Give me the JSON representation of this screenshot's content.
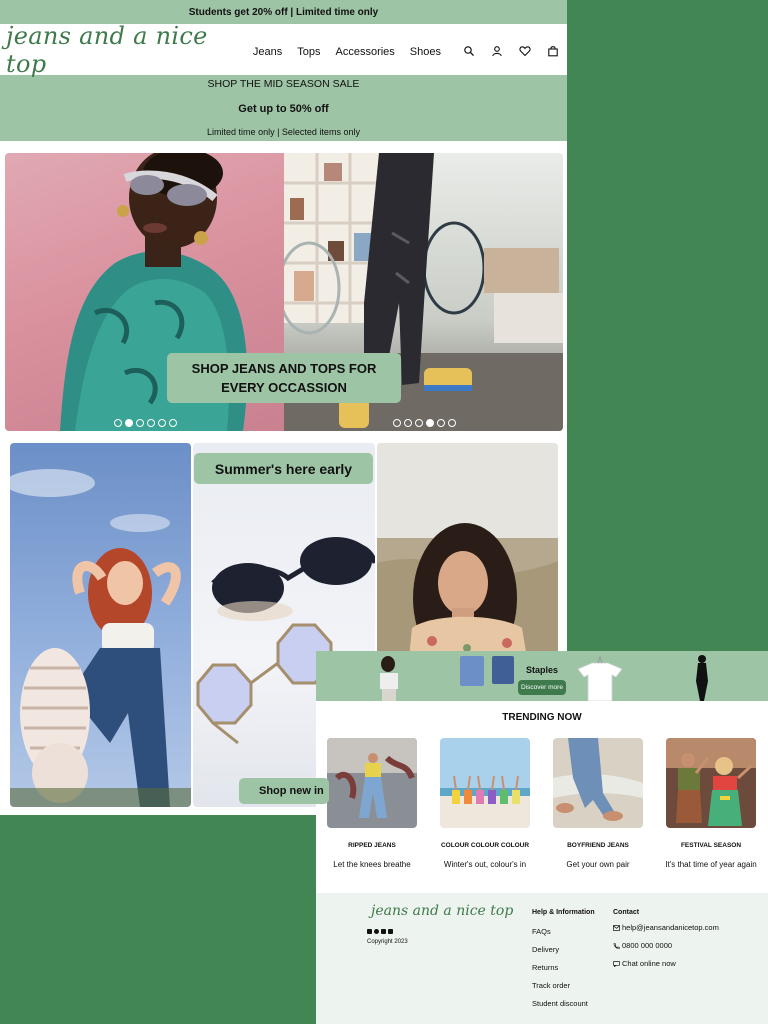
{
  "topbar": {
    "promo": "Students get 20% off | Limited time only"
  },
  "header": {
    "logo": "jeans and a nice top",
    "nav": [
      {
        "label": "Jeans"
      },
      {
        "label": "Tops"
      },
      {
        "label": "Accessories"
      },
      {
        "label": "Shoes"
      }
    ]
  },
  "sale_banner": {
    "line1": "SHOP THE MID SEASON SALE",
    "line2": "Get up to 50% off",
    "line3": "Limited time only | Selected items only"
  },
  "hero": {
    "caption": "SHOP JEANS AND TOPS FOR EVERY OCCASSION",
    "left_dots": {
      "count": 6,
      "active": 2
    },
    "right_dots": {
      "count": 6,
      "active": 4
    }
  },
  "feature_grid": {
    "summer_label": "Summer's here early",
    "shop_button": "Shop new in"
  },
  "staples": {
    "title": "Staples",
    "button": "Discover more"
  },
  "trending": {
    "title": "TRENDING NOW",
    "items": [
      {
        "name": "RIPPED JEANS",
        "tagline": "Let the knees breathe"
      },
      {
        "name": "COLOUR COLOUR COLOUR",
        "tagline": "Winter's out, colour's in"
      },
      {
        "name": "BOYFRIEND JEANS",
        "tagline": "Get your own pair"
      },
      {
        "name": "FESTIVAL SEASON",
        "tagline": "It's that time of year again"
      }
    ]
  },
  "footer": {
    "logo": "jeans and a nice top",
    "copyright": "Copyright 2023",
    "help": {
      "heading": "Help & Information",
      "links": [
        "FAQs",
        "Delivery",
        "Returns",
        "Track order",
        "Student discount"
      ]
    },
    "contact": {
      "heading": "Contact",
      "email": "help@jeansandanicetop.com",
      "phone": "0800 000 0000",
      "chat": "Chat online now"
    }
  },
  "colors": {
    "background_green": "#418653",
    "accent_green": "#9ec4a6",
    "logo_green": "#3e7a4c"
  }
}
